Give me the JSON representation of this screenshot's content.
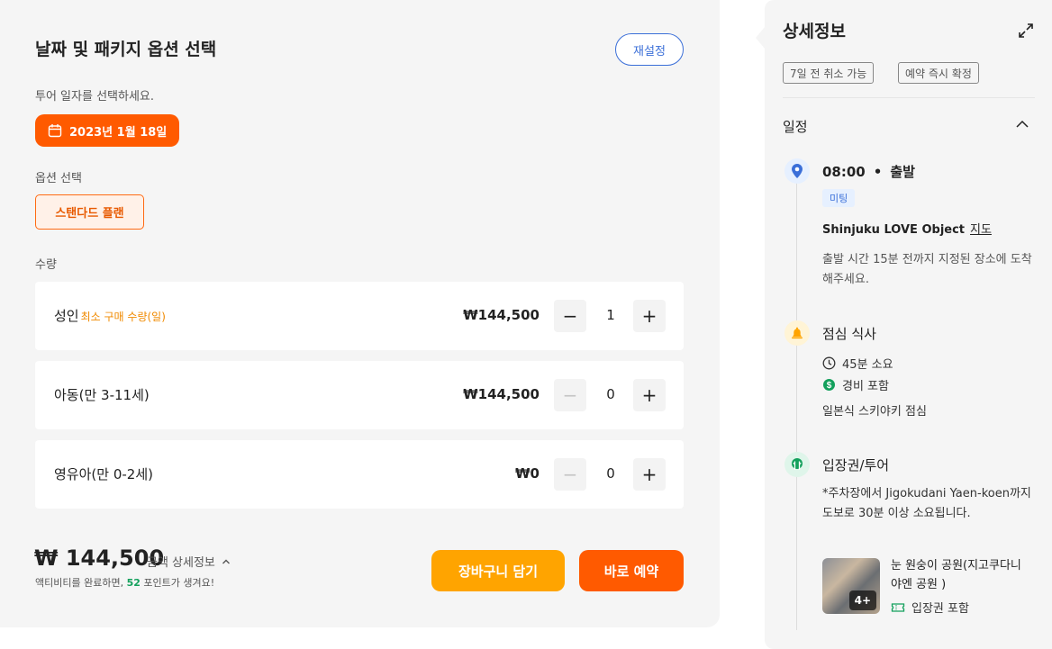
{
  "left": {
    "title": "날짜 및 패키지 옵션 선택",
    "reset_label": "재설정",
    "date_prompt": "투어 일자를 선택하세요.",
    "selected_date": "2023년 1월 18일",
    "option_label": "옵션 선택",
    "selected_option": "스탠다드 플랜",
    "quantity_label": "수량",
    "rows": [
      {
        "name": "성인",
        "note": "최소 구매 수량(일)",
        "price": "₩144,500",
        "qty": "1",
        "minus_disabled": false
      },
      {
        "name": "아동(만 3-11세)",
        "note": "",
        "price": "₩144,500",
        "qty": "0",
        "minus_disabled": true
      },
      {
        "name": "영유아(만 0-2세)",
        "note": "",
        "price": "₩0",
        "qty": "0",
        "minus_disabled": true
      }
    ],
    "total_price": "₩ 144,500",
    "total_detail": "금액 상세정보",
    "points_prefix": "액티비티를 완료하면, ",
    "points_value": "52",
    "points_suffix": " 포인트가 생겨요!",
    "cart_label": "장바구니 담기",
    "book_label": "바로 예약"
  },
  "right": {
    "title": "상세정보",
    "tags": [
      "7일 전 취소 가능",
      "예약 즉시 확정"
    ],
    "section": "일정",
    "events": {
      "departure": {
        "time": "08:00",
        "label": "출발",
        "badge": "미팅",
        "place": "Shinjuku LOVE Object",
        "map_link": "지도",
        "desc": "출발 시간 15분 전까지 지정된 장소에 도착해주세요."
      },
      "lunch": {
        "title": "점심 식사",
        "duration": "45분 소요",
        "cost": "경비 포함",
        "note": "일본식 스키야키 점심"
      },
      "admission": {
        "title": "입장권/투어",
        "desc": "*주차장에서 Jigokudani Yaen-koen까지 도보로 30분 이상 소요됩니다.",
        "spot_name": "눈 원숭이 공원(지고쿠다니 야엔 공원  )",
        "photo_count": "4+",
        "included": "입장권 포함"
      }
    }
  },
  "colors": {
    "accent_orange": "#ff5a00",
    "cart_orange": "#ffa400",
    "blue": "#3b6fd8",
    "green": "#13a05c"
  }
}
